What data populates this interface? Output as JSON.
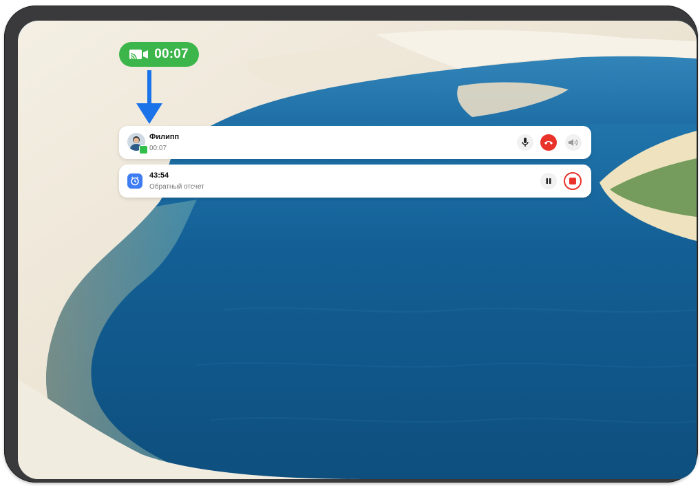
{
  "screencast_indicator": {
    "icon": "screencast-camera-icon",
    "time": "00:07",
    "color": "#3cb54a"
  },
  "annotation_arrow": {
    "color": "#1a73e8"
  },
  "call_notification": {
    "avatar": "contact-avatar",
    "badge_icon": "call-badge-icon",
    "contact_name": "Филипп",
    "duration": "00:07",
    "actions": {
      "mic_icon": "microphone-icon",
      "hangup_icon": "hang-up-icon",
      "speaker_icon": "speaker-icon"
    }
  },
  "timer_notification": {
    "icon": "timer-icon",
    "time": "43:54",
    "label": "Обратный отсчет",
    "actions": {
      "pause_icon": "pause-icon",
      "stop_icon": "stop-icon"
    }
  },
  "colors": {
    "hangup": "#e8322a",
    "timer_accent": "#3d7cf2",
    "device_frame": "#3a3a3c"
  }
}
